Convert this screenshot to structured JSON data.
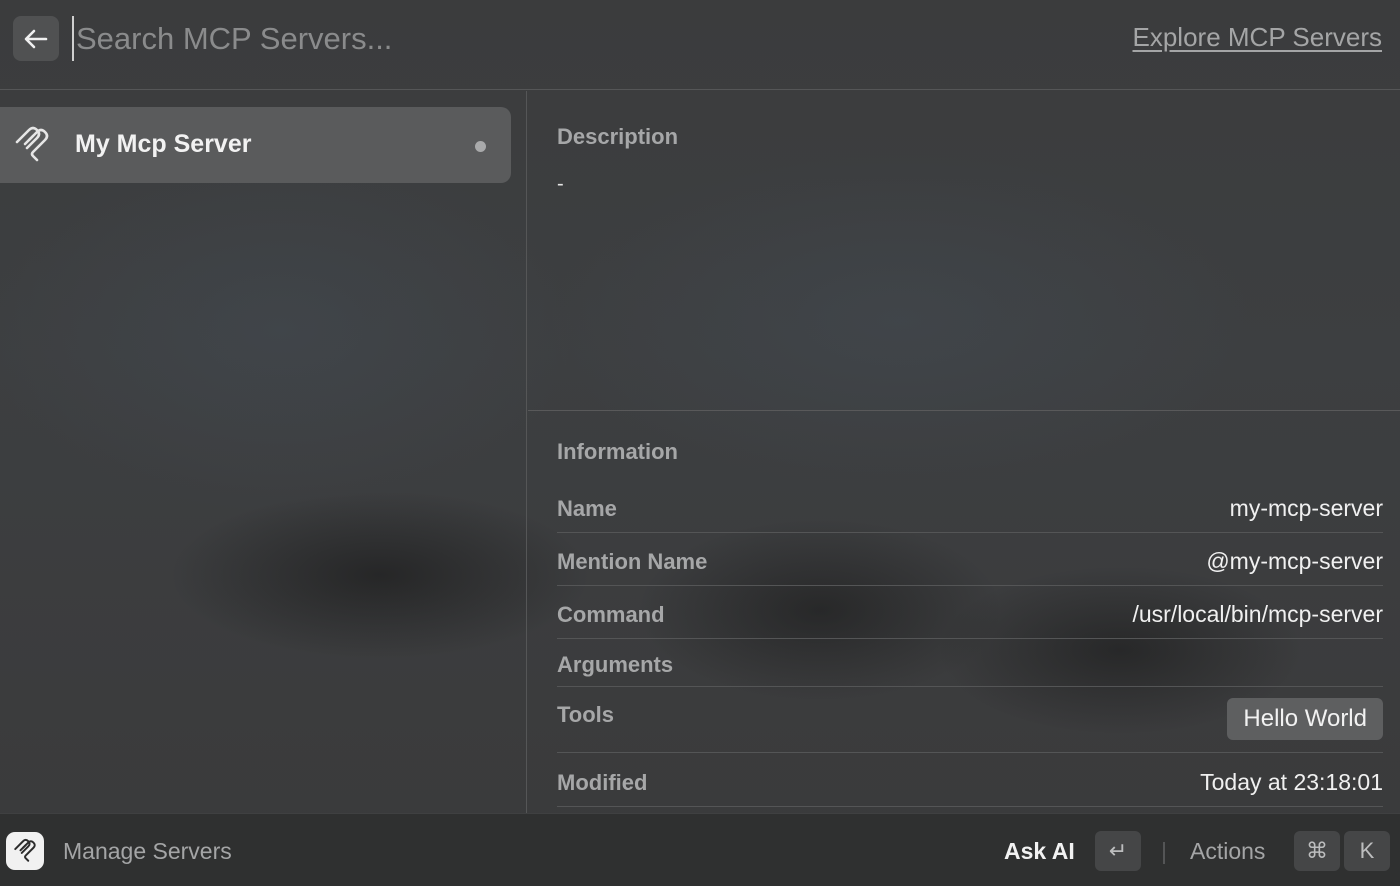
{
  "header": {
    "search_placeholder": "Search MCP Servers...",
    "search_value": "",
    "explore_link": "Explore MCP Servers"
  },
  "sidebar": {
    "items": [
      {
        "label": "My Mcp Server",
        "icon": "mcp-icon",
        "selected": true
      }
    ]
  },
  "detail": {
    "description_title": "Description",
    "description_value": "-",
    "information_title": "Information",
    "rows": [
      {
        "key": "Name",
        "value": "my-mcp-server"
      },
      {
        "key": "Mention Name",
        "value": "@my-mcp-server"
      },
      {
        "key": "Command",
        "value": "/usr/local/bin/mcp-server"
      },
      {
        "key": "Arguments",
        "value": ""
      },
      {
        "key": "Tools",
        "value": "Hello World"
      },
      {
        "key": "Modified",
        "value": "Today at 23:18:01"
      }
    ]
  },
  "footer": {
    "manage_label": "Manage Servers",
    "ask_ai_label": "Ask AI",
    "enter_key": "↵",
    "actions_label": "Actions",
    "cmd_key": "⌘",
    "k_key": "K"
  }
}
